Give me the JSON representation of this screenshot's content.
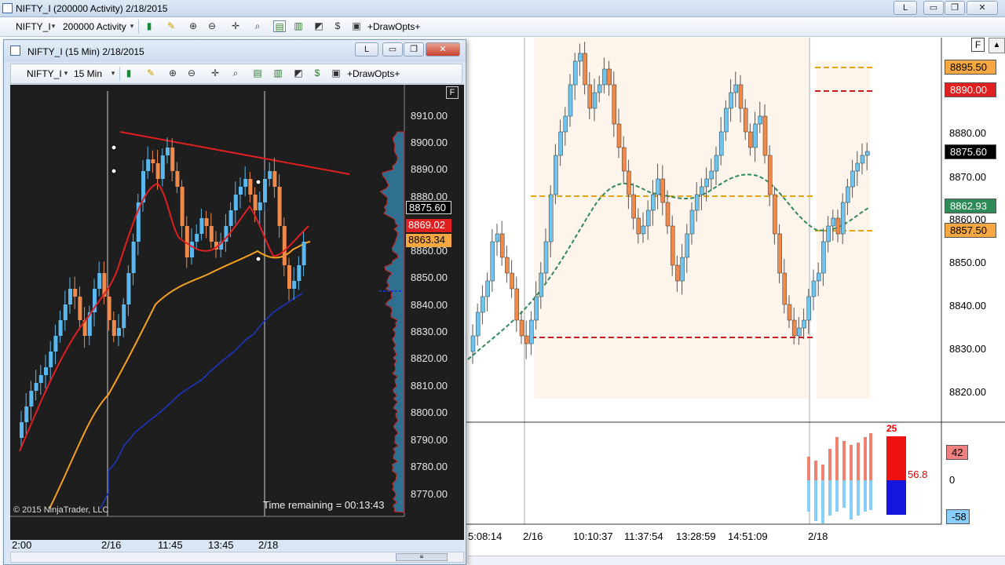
{
  "main_window": {
    "title": "NIFTY_I (200000 Activity)  2/18/2015",
    "link_button": "L",
    "minimize_symbol": "▭",
    "restore_symbol": "❐",
    "close_symbol": "✕"
  },
  "main_toolbar": {
    "instrument": "NIFTY_I",
    "period": "200000 Activity",
    "drawopts": "+DrawOpts+"
  },
  "main_chart": {
    "f_button": "F",
    "price_labels": [
      "8870.00",
      "8860.00",
      "8850.00",
      "8840.00",
      "8830.00",
      "8820.00"
    ],
    "price_boxes": [
      {
        "text": "8895.50",
        "bg": "#f5a742"
      },
      {
        "text": "8890.00",
        "bg": "#e02020"
      },
      {
        "text": "8880.00",
        "bg": ""
      },
      {
        "text": "8875.60",
        "bg": "#000000"
      },
      {
        "text": "8862.93",
        "bg": "#2e8b57"
      },
      {
        "text": "8857.50",
        "bg": "#f5a742"
      }
    ],
    "time_labels": [
      "5:08:14",
      "2/16",
      "10:10:37",
      "11:37:54",
      "13:28:59",
      "14:51:09",
      "2/18"
    ],
    "indicator": {
      "top": "25",
      "value": "56.8",
      "right_labels": [
        "42",
        "0",
        "-58"
      ]
    }
  },
  "child_window": {
    "title": "NIFTY_I (15 Min)  2/18/2015",
    "link_button": "L",
    "minimize_symbol": "▭",
    "restore_symbol": "❐",
    "close_symbol": "✕"
  },
  "child_toolbar": {
    "instrument": "NIFTY_I",
    "period": "15 Min",
    "drawopts": "+DrawOpts+"
  },
  "child_chart": {
    "f_button": "F",
    "price_labels": [
      "8910.00",
      "8900.00",
      "8890.00",
      "8880.00",
      "8860.00",
      "8850.00",
      "8840.00",
      "8830.00",
      "8820.00",
      "8810.00",
      "8800.00",
      "8790.00",
      "8780.00",
      "8770.00"
    ],
    "price_boxes": [
      {
        "text": "8875.60",
        "bg": "#000000",
        "fg": "#ffffff"
      },
      {
        "text": "8869.02",
        "bg": "#e02020",
        "fg": "#ffffff"
      },
      {
        "text": "8863.34",
        "bg": "#f5a742",
        "fg": "#000000"
      }
    ],
    "time_labels": [
      "2:00",
      "2/16",
      "11:45",
      "13:45",
      "2/18"
    ],
    "copyright": "© 2015 NinjaTrader, LLC",
    "time_remaining": "Time remaining = 00:13:43"
  }
}
